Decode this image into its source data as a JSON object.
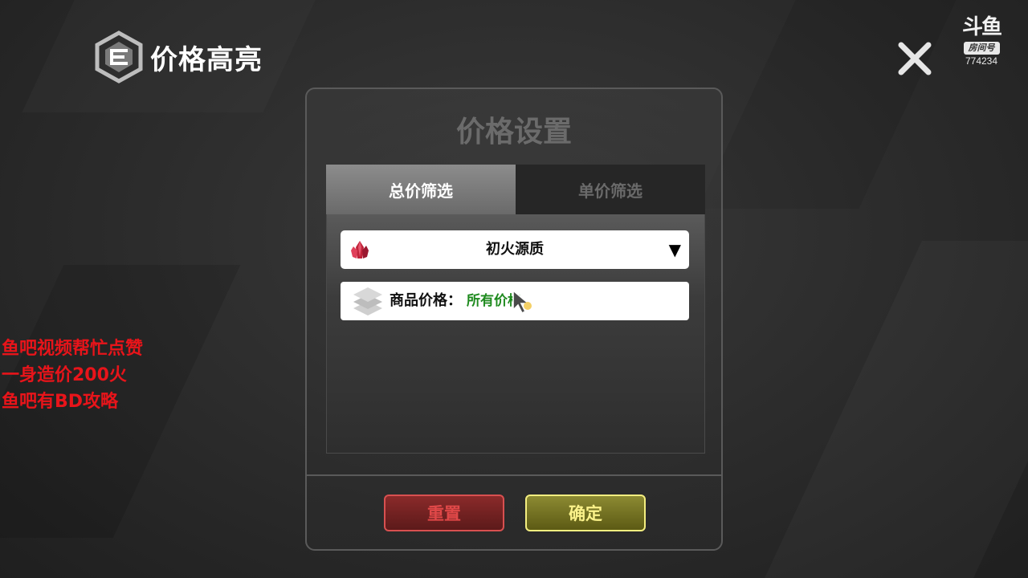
{
  "header": {
    "title": "价格高亮",
    "logo_icon": "hexagon-e-logo-icon"
  },
  "close_icon": "close-icon",
  "room_badge": {
    "brand": "斗鱼",
    "label": "房间号",
    "number": "774234"
  },
  "overlay": {
    "color": "#e8141a",
    "lines": [
      "鱼吧视频帮忙点赞",
      "一身造价200火",
      "鱼吧有BD攻略"
    ]
  },
  "dialog": {
    "title": "价格设置",
    "tabs": [
      {
        "label": "总价筛选",
        "active": true
      },
      {
        "label": "单价筛选",
        "active": false
      }
    ],
    "currency_dropdown": {
      "icon": "red-crystal-icon",
      "value": "初火源质",
      "arrow_icon": "triangle-down-icon"
    },
    "price_field": {
      "icon": "layers-icon",
      "label": "商品价格：",
      "value": "所有价格"
    },
    "buttons": {
      "reset": "重置",
      "confirm": "确定"
    },
    "colors": {
      "reset": "#e04848",
      "confirm": "#fbf28a",
      "price_value": "#1e8a1e"
    }
  }
}
